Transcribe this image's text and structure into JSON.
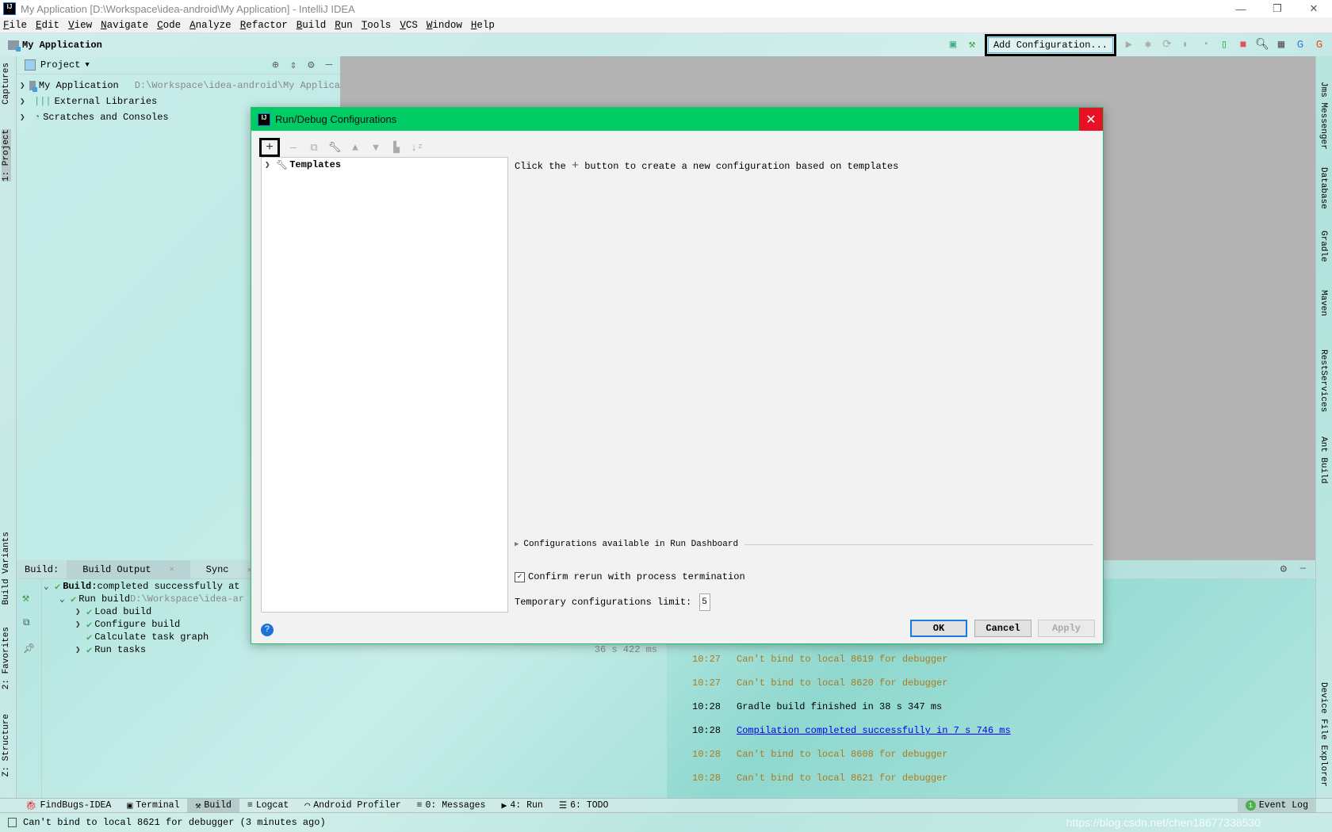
{
  "window": {
    "title": "My Application [D:\\Workspace\\idea-android\\My Application] - IntelliJ IDEA",
    "logo": "IJ"
  },
  "menu": [
    "File",
    "Edit",
    "View",
    "Navigate",
    "Code",
    "Analyze",
    "Refactor",
    "Build",
    "Run",
    "Tools",
    "VCS",
    "Window",
    "Help"
  ],
  "navbar": {
    "project": "My Application",
    "add_config": "Add Configuration..."
  },
  "left_stripe": [
    "Captures",
    "1: Project",
    "Build Variants",
    "2: Favorites",
    "Z: Structure"
  ],
  "right_stripe": [
    "Jms Messenger",
    "Database",
    "Gradle",
    "Maven",
    "RestServices",
    "Ant Build",
    "Device File Explorer"
  ],
  "project_panel": {
    "title": "Project",
    "items": [
      {
        "label": "My Application",
        "path": "D:\\Workspace\\idea-android\\My Applica"
      },
      {
        "label": "External Libraries"
      },
      {
        "label": "Scratches and Consoles"
      }
    ]
  },
  "build_panel": {
    "label": "Build:",
    "tabs": [
      "Build Output",
      "Sync"
    ],
    "rows": [
      {
        "bold": "Build:",
        "text": " completed successfully at"
      },
      {
        "text": "Run build",
        "path": " D:\\Workspace\\idea-ar"
      },
      {
        "text": "Load build"
      },
      {
        "text": "Configure build"
      },
      {
        "text": "Calculate task graph"
      },
      {
        "text": "Run tasks"
      }
    ],
    "duration": "36 s 422 ms"
  },
  "event_log": [
    {
      "time": "10:27",
      "text": "Can't bind to local 8619 for debugger",
      "kind": "warn"
    },
    {
      "time": "10:27",
      "text": "Can't bind to local 8620 for debugger",
      "kind": "warn"
    },
    {
      "time": "10:28",
      "text": "Gradle build finished in 38 s 347 ms",
      "kind": "info"
    },
    {
      "time": "10:28",
      "text": "Compilation completed successfully in 7 s 746 ms",
      "kind": "link"
    },
    {
      "time": "10:28",
      "text": "Can't bind to local 8608 for debugger",
      "kind": "warn"
    },
    {
      "time": "10:28",
      "text": "Can't bind to local 8621 for debugger",
      "kind": "warn"
    }
  ],
  "bottom_tools": [
    "FindBugs-IDEA",
    "Terminal",
    "Build",
    "Logcat",
    "Android Profiler",
    "0: Messages",
    "4: Run",
    "6: TODO"
  ],
  "event_log_button": "Event Log",
  "event_log_count": "1",
  "status": "Can't bind to local 8621 for debugger (3 minutes ago)",
  "watermark": "https://blog.csdn.net/chen18677338530",
  "dialog": {
    "title": "Run/Debug Configurations",
    "tree_root": "Templates",
    "hint_before": "Click the",
    "hint_after": "button to create a new configuration based on templates",
    "dashboard": "Configurations available in Run Dashboard",
    "confirm_label": "Confirm rerun with process termination",
    "confirm_checked": true,
    "limit_label": "Temporary configurations limit:",
    "limit_value": "5",
    "ok": "OK",
    "cancel": "Cancel",
    "apply": "Apply",
    "help": "?"
  },
  "colors": {
    "dialog_title": "#00cc66",
    "close": "#e81123",
    "warn": "#b07a1a",
    "link": "#0000ee"
  }
}
